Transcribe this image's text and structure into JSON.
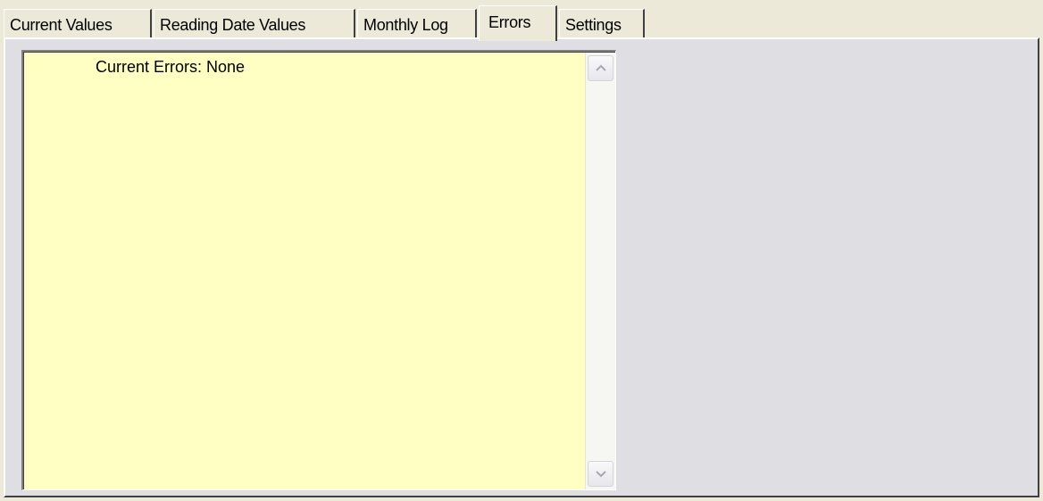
{
  "tabs": [
    {
      "label": "Current Values",
      "active": false
    },
    {
      "label": "Reading Date Values",
      "active": false
    },
    {
      "label": "Monthly Log",
      "active": false
    },
    {
      "label": "Errors",
      "active": true
    },
    {
      "label": "Settings",
      "active": false
    }
  ],
  "errors_panel": {
    "text": "Current Errors: None"
  },
  "colors": {
    "text_area_background": "#ffffc4",
    "panel_background": "#dfdfe3",
    "window_background": "#ece9d8"
  },
  "icons": {
    "scroll_up": "chevron-up-icon",
    "scroll_down": "chevron-down-icon"
  }
}
